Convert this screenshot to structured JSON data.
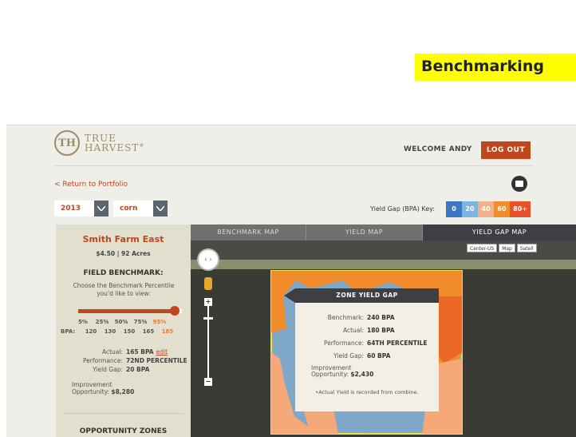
{
  "slide": {
    "title": "Benchmarking"
  },
  "header": {
    "logo_mark": "TH",
    "logo_line1": "TRUE",
    "logo_line2": "HARVEST°",
    "welcome": "WELCOME ANDY",
    "logout": "LOG OUT"
  },
  "nav": {
    "return_link": "< Return to Portfolio"
  },
  "filters": {
    "year": "2013",
    "crop": "corn"
  },
  "key": {
    "label": "Yield Gap (BPA) Key:",
    "cells": [
      {
        "text": "0",
        "color": "#3a78c4"
      },
      {
        "text": "20",
        "color": "#7fb3e0"
      },
      {
        "text": "40",
        "color": "#f3b18a"
      },
      {
        "text": "60",
        "color": "#f08c2a"
      },
      {
        "text": "80+",
        "color": "#e8502a"
      }
    ]
  },
  "panel": {
    "farm_name": "Smith Farm East",
    "farm_meta": "$4.50 | 92 Acres",
    "benchmark_title": "FIELD BENCHMARK:",
    "benchmark_desc": "Choose the Benchmark Percentile you'd like to view:",
    "slider_selected": "95%",
    "percentiles": [
      "5%",
      "25%",
      "50%",
      "75%",
      "95%"
    ],
    "bpa_label": "BPA:",
    "bpa_values": [
      "120",
      "130",
      "150",
      "165",
      "185"
    ],
    "actual_label": "Actual:",
    "actual_value": "165 BPA",
    "edit": "edit",
    "performance_label": "Performance:",
    "performance_value": "72ND PERCENTILE",
    "yield_gap_label": "Yield Gap:",
    "yield_gap_value": "20 BPA",
    "improvement_label_1": "Improvement",
    "improvement_label_2": "Opportunity:",
    "improvement_value": "$8,280",
    "opportunity_title": "OPPORTUNITY ZONES"
  },
  "map": {
    "tabs": [
      "BENCHMARK MAP",
      "YIELD MAP",
      "YIELD GAP MAP"
    ],
    "active_tab": "YIELD GAP MAP",
    "controls": [
      "Center-US",
      "Map",
      "Satell"
    ],
    "popup": {
      "title": "ZONE YIELD GAP",
      "benchmark_label": "Benchmark:",
      "benchmark_value": "240 BPA",
      "actual_label": "Actual:",
      "actual_value": "180 BPA",
      "performance_label": "Performance:",
      "performance_value": "64TH PERCENTILE",
      "yield_gap_label": "Yield Gap:",
      "yield_gap_value": "60 BPA",
      "improvement_label_1": "Improvement",
      "improvement_label_2": "Opportunity:",
      "improvement_value": "$2,430",
      "note": "•Actual Yield is recorded from combine."
    }
  }
}
